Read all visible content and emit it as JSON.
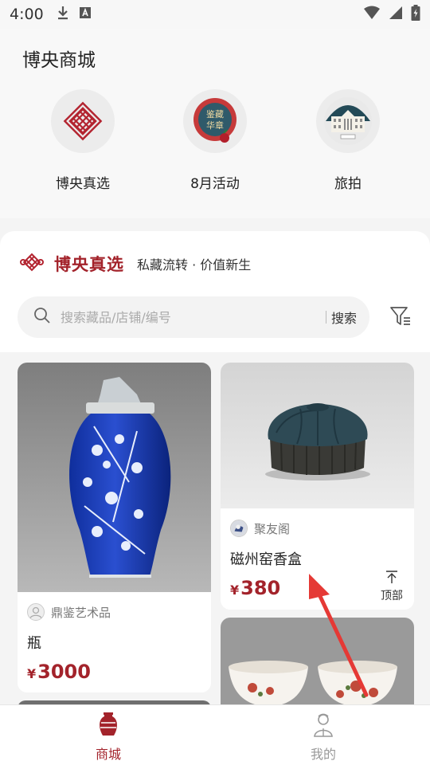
{
  "status_bar": {
    "time": "4:00",
    "icons": [
      "download-icon",
      "keyboard-a-icon",
      "wifi-icon",
      "signal-icon",
      "battery-charging-icon"
    ]
  },
  "header": {
    "title": "博央商城",
    "categories": [
      {
        "label": "博央真选",
        "icon": "endless-knot-logo"
      },
      {
        "label": "8月活动",
        "icon": "event-seal",
        "seal_text": "鉴藏华章"
      },
      {
        "label": "旅拍",
        "icon": "museum-building"
      }
    ]
  },
  "section": {
    "title": "博央真选",
    "slogan": "私藏流转 · 价值新生",
    "search": {
      "placeholder": "搜索藏品/店铺/编号",
      "button_label": "搜索"
    }
  },
  "products": [
    {
      "shop": "鼎鉴艺术品",
      "name": "瓶",
      "currency": "¥",
      "price": "3000",
      "image": "blue-white-porcelain-vase"
    },
    {
      "shop": "聚友阁",
      "name": "磁州窑香盒",
      "currency": "¥",
      "price": "380",
      "image": "dark-glazed-melon-box"
    },
    {
      "image": "painted-porcelain-cups"
    }
  ],
  "back_to_top": {
    "label": "顶部"
  },
  "tabs": [
    {
      "label": "商城",
      "icon": "vase-icon",
      "active": true
    },
    {
      "label": "我的",
      "icon": "person-icon",
      "active": false
    }
  ],
  "colors": {
    "accent": "#a3232b",
    "annotation_arrow": "#e53935"
  }
}
